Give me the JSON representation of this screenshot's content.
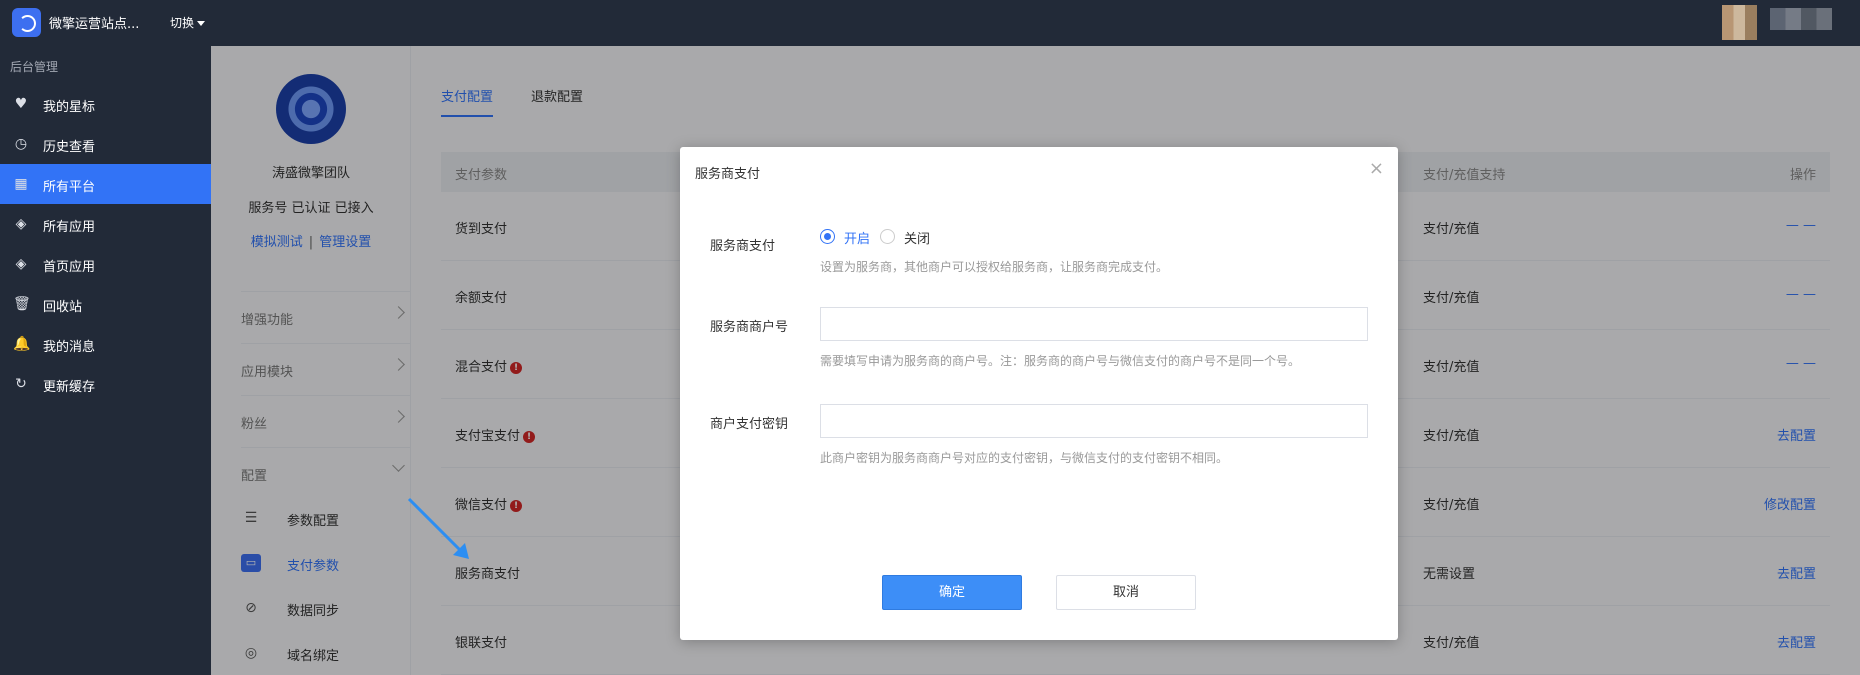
{
  "topbar": {
    "site_name": "微擎运营站点...",
    "switch_label": "切换"
  },
  "sidebar": {
    "section_label": "后台管理",
    "items": [
      {
        "label": "我的星标",
        "icon": "heart-icon"
      },
      {
        "label": "历史查看",
        "icon": "clock-icon"
      },
      {
        "label": "所有平台",
        "icon": "grid-icon",
        "active": true
      },
      {
        "label": "所有应用",
        "icon": "cube-icon"
      },
      {
        "label": "首页应用",
        "icon": "cube-icon"
      },
      {
        "label": "回收站",
        "icon": "trash-icon"
      },
      {
        "label": "我的消息",
        "icon": "bell-icon"
      },
      {
        "label": "更新缓存",
        "icon": "refresh-icon"
      }
    ]
  },
  "subpanel": {
    "team_name": "涛盛微擎团队",
    "status": "服务号 已认证 已接入",
    "link_simulate": "模拟测试",
    "link_separator": "|",
    "link_manage": "管理设置",
    "groups": [
      "增强功能",
      "应用模块",
      "粉丝",
      "配置"
    ],
    "config_items": [
      {
        "label": "参数配置",
        "icon": "list-icon"
      },
      {
        "label": "支付参数",
        "icon": "wallet-icon",
        "active": true
      },
      {
        "label": "数据同步",
        "icon": "sync-icon"
      },
      {
        "label": "域名绑定",
        "icon": "globe-icon"
      }
    ]
  },
  "tabs": [
    {
      "label": "支付配置",
      "active": true
    },
    {
      "label": "退款配置"
    }
  ],
  "table": {
    "headers": {
      "param": "支付参数",
      "support": "支付/充值支持",
      "action": "操作"
    },
    "rows": [
      {
        "name": "货到支付",
        "warn": false,
        "support": "支付/充值",
        "action": "— —"
      },
      {
        "name": "余额支付",
        "warn": false,
        "support": "支付/充值",
        "action": "— —"
      },
      {
        "name": "混合支付",
        "warn": true,
        "support": "支付/充值",
        "action": "— —"
      },
      {
        "name": "支付宝支付",
        "warn": true,
        "support": "支付/充值",
        "action": "去配置"
      },
      {
        "name": "微信支付",
        "warn": true,
        "support": "支付/充值",
        "action": "修改配置"
      },
      {
        "name": "服务商支付",
        "warn": false,
        "support": "无需设置",
        "action": "去配置"
      },
      {
        "name": "银联支付",
        "warn": false,
        "support": "支付/充值",
        "action": "去配置"
      }
    ],
    "warn_glyph": "!"
  },
  "modal": {
    "title": "服务商支付",
    "close_glyph": "×",
    "field_service_pay_label": "服务商支付",
    "radio_on_label": "开启",
    "radio_off_label": "关闭",
    "hint_service_pay": "设置为服务商，其他商户可以授权给服务商，让服务商完成支付。",
    "field_merchant_no_label": "服务商商户号",
    "merchant_no_value": "",
    "hint_merchant_no": "需要填写申请为服务商的商户号。注：服务商的商户号与微信支付的商户号不是同一个号。",
    "field_secret_label": "商户支付密钥",
    "secret_value": "",
    "hint_secret": "此商户密钥为服务商商户号对应的支付密钥，与微信支付的支付密钥不相同。",
    "confirm_label": "确定",
    "cancel_label": "取消"
  },
  "colors": {
    "accent": "#3273f6",
    "sidebar_bg": "#222a38",
    "warn": "#d12727"
  }
}
